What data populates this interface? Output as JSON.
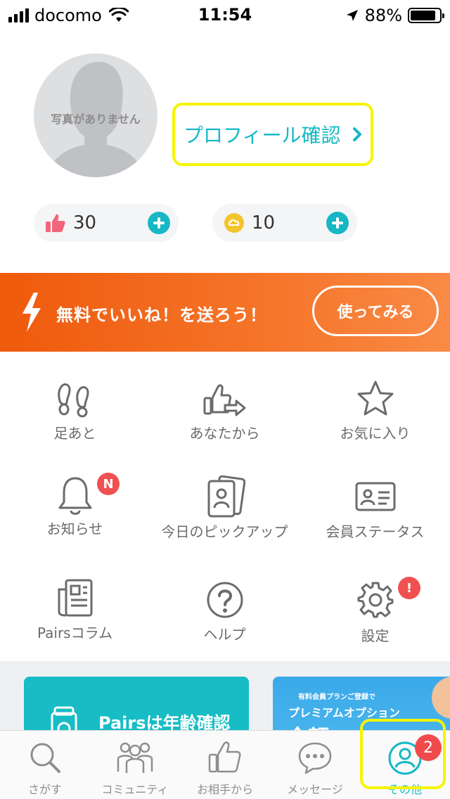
{
  "status_bar": {
    "carrier": "docomo",
    "time": "11:54",
    "battery": "88%",
    "battery_level": 0.88
  },
  "profile": {
    "no_photo_text": "写真がありません",
    "profile_check_label": "プロフィール確認",
    "likes_count": "30",
    "points_count": "10"
  },
  "banner": {
    "text": "無料でいいね！を送ろう！",
    "button_label": "使ってみる"
  },
  "menu": {
    "items": [
      {
        "label": "足あと",
        "icon": "footprints-icon"
      },
      {
        "label": "あなたから",
        "icon": "thumbs-up-send-icon"
      },
      {
        "label": "お気に入り",
        "icon": "star-icon"
      },
      {
        "label": "お知らせ",
        "icon": "bell-icon",
        "badge": "N"
      },
      {
        "label": "今日のピックアップ",
        "icon": "profile-cards-icon"
      },
      {
        "label": "会員ステータス",
        "icon": "id-card-icon"
      },
      {
        "label": "Pairsコラム",
        "icon": "newspaper-icon"
      },
      {
        "label": "ヘルプ",
        "icon": "help-circle-icon"
      },
      {
        "label": "設定",
        "icon": "gear-icon",
        "badge": "!"
      }
    ]
  },
  "cards": {
    "age_verification": "Pairsは年齢確認",
    "premium_small": "有料会員プランご登録で",
    "premium_title": "プレミアムオプション",
    "premium_partial": "全額"
  },
  "tabbar": {
    "tabs": [
      {
        "label": "さがす",
        "icon": "search-icon"
      },
      {
        "label": "コミュニティ",
        "icon": "community-icon"
      },
      {
        "label": "お相手から",
        "icon": "thumbs-up-icon"
      },
      {
        "label": "メッセージ",
        "icon": "message-icon"
      },
      {
        "label": "その他",
        "icon": "person-icon",
        "active": true
      }
    ],
    "other_badge": "2"
  },
  "colors": {
    "accent": "#15b8c4",
    "banner": "#ef5a0c",
    "highlight": "#f6f400",
    "badge": "#f05050"
  }
}
